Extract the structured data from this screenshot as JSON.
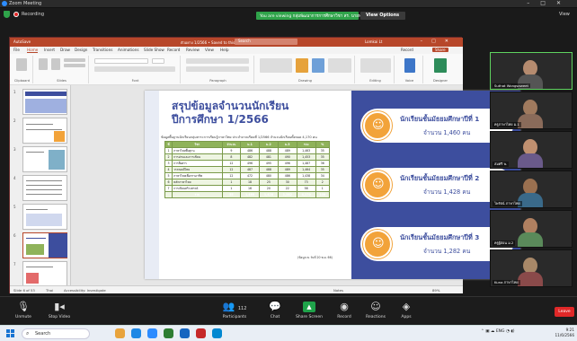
{
  "zoom": {
    "window_title": "Zoom Meeting",
    "recording_label": "Recording",
    "viewing_banner": "You are viewing กลุ่มพัฒนาการการศึกษาวิชา สร. นายพล",
    "view_options": "View Options",
    "view_button": "View"
  },
  "ppt": {
    "autosave": "AutoSave",
    "docname": "ตัวอย่าง 1/2566 • Saved to this PC",
    "search_placeholder": "Search",
    "user": "Lomkai Lt",
    "menu": [
      "File",
      "Home",
      "Insert",
      "Draw",
      "Design",
      "Transitions",
      "Animations",
      "Slide Show",
      "Record",
      "Review",
      "View",
      "Help"
    ],
    "record_btn": "Record",
    "share_btn": "Share",
    "ribbon_groups": [
      "Clipboard",
      "Slides",
      "Font",
      "Paragraph",
      "Drawing",
      "Editing",
      "Voice",
      "Designer"
    ],
    "status_slide": "Slide 6 of 53",
    "status_lang": "Thai",
    "status_access": "Accessibility: Investigate",
    "status_notes": "Notes",
    "status_zoom": "89%",
    "thumb_numbers": [
      "1",
      "2",
      "3",
      "4",
      "5",
      "6",
      "7"
    ]
  },
  "slide": {
    "title_line1": "สรุปข้อมูลจำนวนนักเรียน",
    "title_line2": "ปีการศึกษา 1/2566",
    "note": "ข้อมูลพื้นฐานนักเรียนกลุ่มสาระการเรียนรู้ภาษาไทย ประจำภาคเรียนที่ 1/2566 จำนวนนักเรียนทั้งหมด 4,170 คน",
    "table": {
      "headers": [
        "ที่",
        "วิชา",
        "จำนวน",
        "ม.1",
        "ม.2",
        "ม.3",
        "รวม",
        "%"
      ],
      "rows": [
        [
          "1",
          "ภาษาไทยพื้นฐาน",
          "9",
          "486",
          "488",
          "489",
          "1,463",
          "35"
        ],
        [
          "2",
          "การอ่านและการเขียน",
          "8",
          "482",
          "481",
          "490",
          "1,453",
          "35"
        ],
        [
          "3",
          "การสื่อสาร",
          "12",
          "496",
          "495",
          "496",
          "1,487",
          "36"
        ],
        [
          "4",
          "วรรณคดีไทย",
          "12",
          "487",
          "488",
          "489",
          "1,464",
          "35"
        ],
        [
          "5",
          "ภาษาไทยเพื่อการอาชีพ",
          "12",
          "472",
          "480",
          "486",
          "1,438",
          "34"
        ],
        [
          "6",
          "หลักภาษาไทย",
          "1",
          "18",
          "25",
          "30",
          "73",
          "2"
        ],
        [
          "7",
          "การเขียนสร้างสรรค์",
          "1",
          "16",
          "20",
          "22",
          "58",
          "1"
        ]
      ],
      "total": [
        "",
        "รวม",
        "55",
        "1,460",
        "1,428",
        "1,282",
        "4,170",
        "100"
      ]
    },
    "table_source": "(ข้อมูล ณ วันที่ 20 พ.ย. 66)",
    "cards": [
      {
        "heading": "นักเรียนชั้นมัธยมศึกษาปีที่ 1",
        "count": "จำนวน 1,460 คน"
      },
      {
        "heading": "นักเรียนชั้นมัธยมศึกษาปีที่ 2",
        "count": "จำนวน 1,428 คน"
      },
      {
        "heading": "นักเรียนชั้นมัธยมศึกษาปีที่ 3",
        "count": "จำนวน 1,282 คน"
      }
    ]
  },
  "participants": [
    {
      "name": "Suthat Wongsaweet"
    },
    {
      "name": "ครูภาษาไทย ม.1"
    },
    {
      "name": "สมศรี พ."
    },
    {
      "name": "ไพรัตน์ ภาษาไทย"
    },
    {
      "name": "ครูผู้สอน ม.2"
    },
    {
      "name": "Kuna ภาษาไทย"
    }
  ],
  "toolbar": {
    "unmute": "Unmute",
    "stop_video": "Stop Video",
    "participants": "Participants",
    "participants_count": "112",
    "chat": "Chat",
    "share_screen": "Share Screen",
    "record": "Record",
    "reactions": "Reactions",
    "apps": "Apps",
    "leave": "Leave"
  },
  "taskbar": {
    "search": "Search",
    "tray_lang": "ENG",
    "time": "9:21",
    "date": "11/6/2566"
  }
}
